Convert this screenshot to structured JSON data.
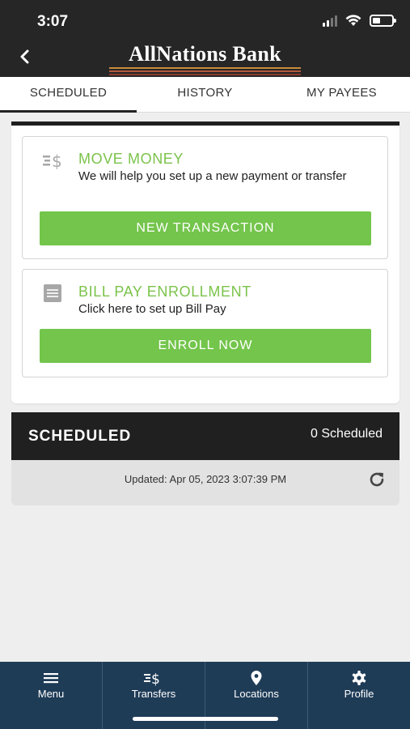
{
  "status": {
    "time": "3:07"
  },
  "header": {
    "logo": "AllNations Bank"
  },
  "tabs": [
    {
      "label": "SCHEDULED",
      "active": true
    },
    {
      "label": "HISTORY",
      "active": false
    },
    {
      "label": "MY PAYEES",
      "active": false
    }
  ],
  "move_money": {
    "icon": "transfer-dollar-icon",
    "title": "MOVE MONEY",
    "description": "We will help you set up a new payment or transfer",
    "button": "NEW TRANSACTION"
  },
  "bill_pay": {
    "icon": "document-icon",
    "title": "BILL PAY ENROLLMENT",
    "description": "Click here to set up Bill Pay",
    "button": "ENROLL NOW"
  },
  "scheduled": {
    "title": "SCHEDULED",
    "count": "0 Scheduled",
    "updated": "Updated: Apr 05, 2023 3:07:39 PM"
  },
  "bottom_nav": [
    {
      "label": "Menu",
      "icon": "menu-icon"
    },
    {
      "label": "Transfers",
      "icon": "transfers-icon"
    },
    {
      "label": "Locations",
      "icon": "location-pin-icon"
    },
    {
      "label": "Profile",
      "icon": "gear-icon"
    }
  ],
  "colors": {
    "header": "#262626",
    "accent_green": "#73c54b",
    "nav_bg": "#1f3c57",
    "logo_lines": [
      "#c98a3c",
      "#b25a3a",
      "#8c3b2d"
    ]
  }
}
